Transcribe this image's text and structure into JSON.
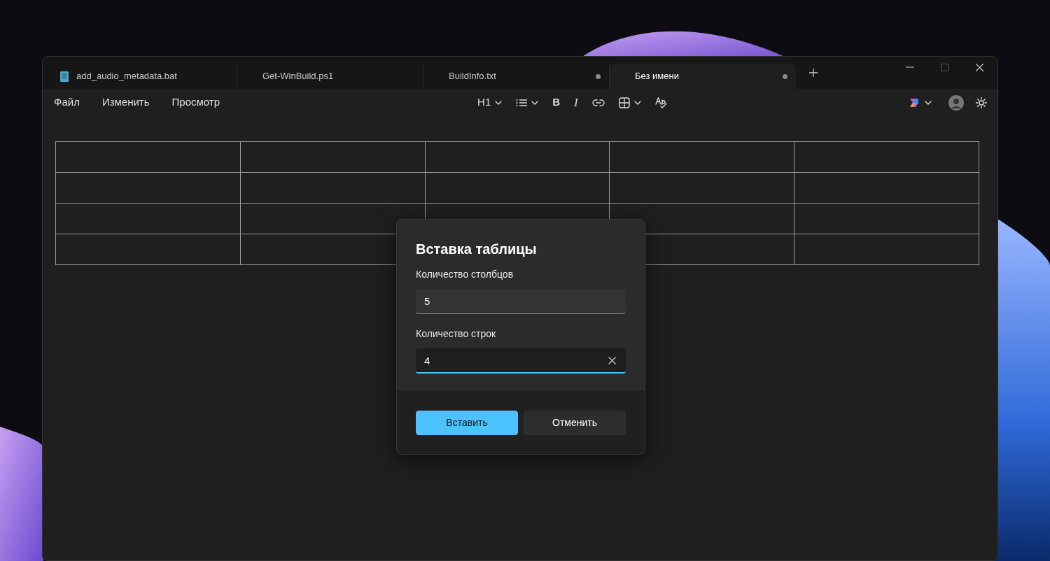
{
  "window": {
    "tabs": [
      {
        "label": "add_audio_metadata.bat",
        "selected": false,
        "unsaved": false,
        "file_icon": true
      },
      {
        "label": "Get-WinBuild.ps1",
        "selected": false,
        "unsaved": false,
        "file_icon": false
      },
      {
        "label": "BuildInfo.txt",
        "selected": false,
        "unsaved": true,
        "file_icon": false
      },
      {
        "label": "Без имени",
        "selected": true,
        "unsaved": true,
        "file_icon": false
      }
    ]
  },
  "menu": [
    "Файл",
    "Изменить",
    "Просмотр"
  ],
  "toolbar": [
    {
      "kind": "heading",
      "label": "H1",
      "dropdown": true
    },
    {
      "kind": "list",
      "dropdown": true
    },
    {
      "kind": "bold",
      "label": "B",
      "dropdown": false
    },
    {
      "kind": "italic",
      "label": "I",
      "dropdown": false
    },
    {
      "kind": "link",
      "dropdown": false
    },
    {
      "kind": "table",
      "dropdown": true
    },
    {
      "kind": "spellcheck",
      "dropdown": false
    }
  ],
  "dialog": {
    "title": "Вставка таблицы",
    "fields": [
      {
        "label": "Количество столбцов",
        "value": "5",
        "focused": false
      },
      {
        "label": "Количество строк",
        "value": "4",
        "focused": true
      }
    ],
    "buttons": [
      {
        "label": "Вставить",
        "primary": true
      },
      {
        "label": "Отменить",
        "primary": false
      }
    ]
  }
}
